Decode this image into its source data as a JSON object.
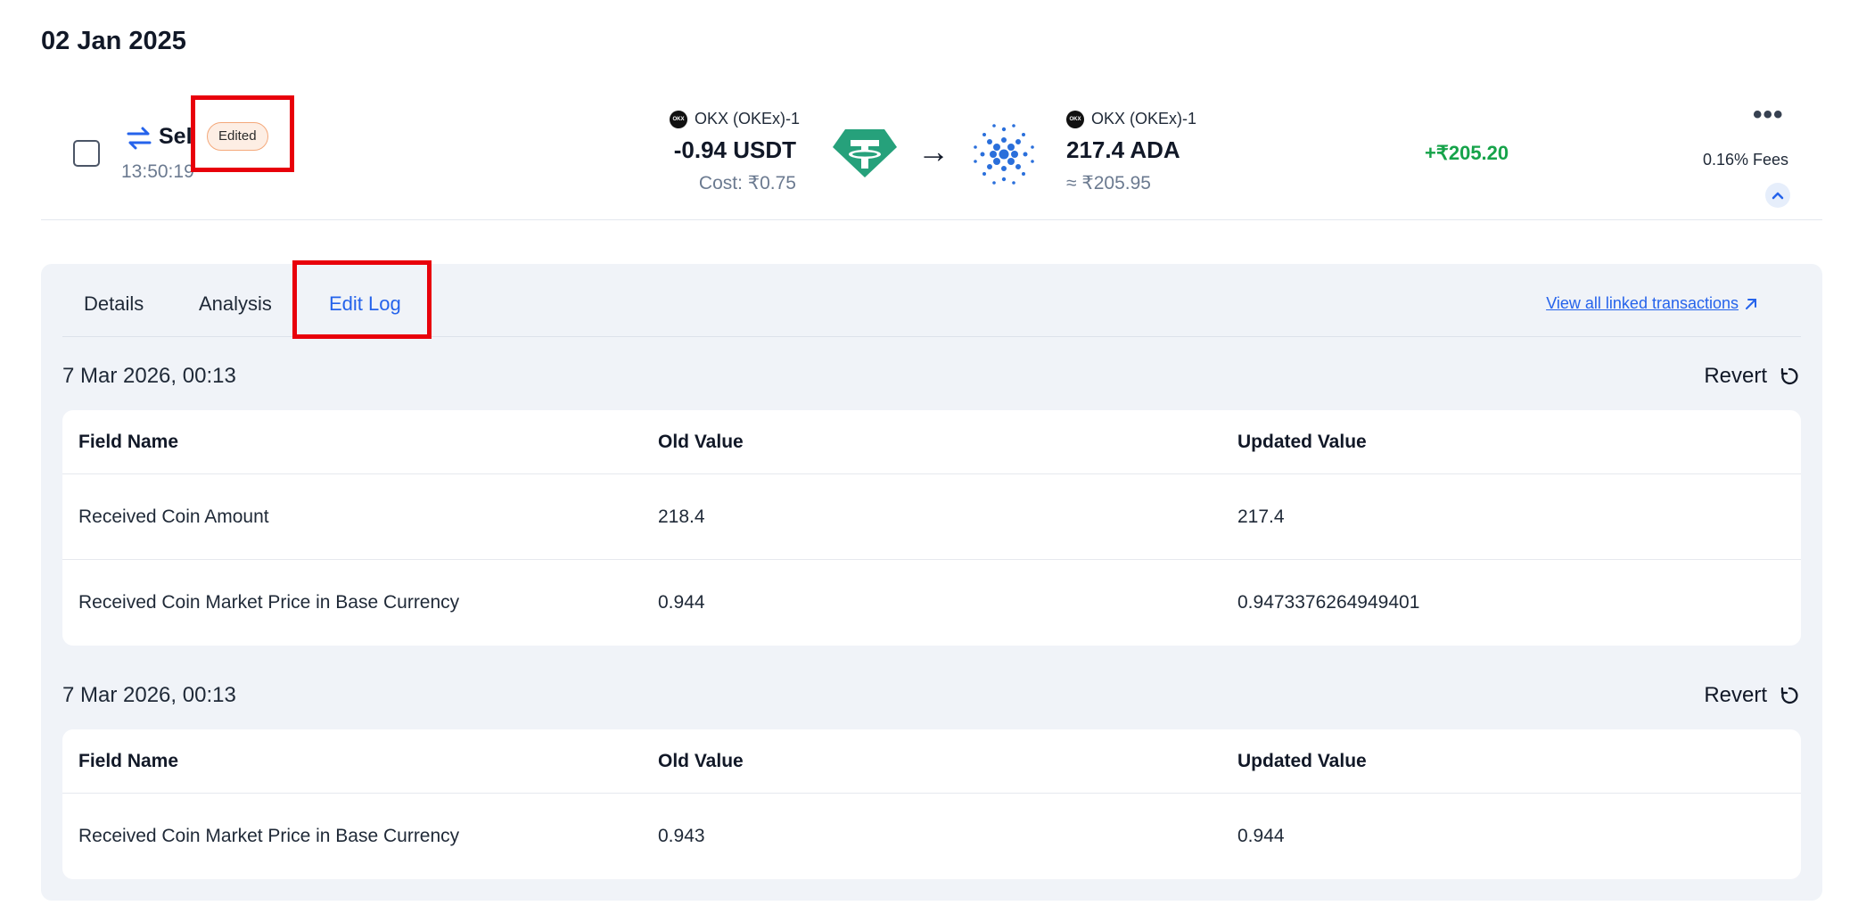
{
  "date_header": "02 Jan 2025",
  "transaction": {
    "type_label": "Sell",
    "edited_badge": "Edited",
    "time": "13:50:19",
    "sent": {
      "exchange": "OKX (OKEx)-1",
      "exchange_logo_text": "OKX",
      "amount": "-0.94 USDT",
      "cost": "Cost: ₹0.75",
      "coin_icon": "tether-icon"
    },
    "received": {
      "exchange": "OKX (OKEx)-1",
      "exchange_logo_text": "OKX",
      "amount": "217.4 ADA",
      "value": "≈ ₹205.95",
      "coin_icon": "cardano-icon"
    },
    "pnl": "+₹205.20",
    "fees": "0.16% Fees",
    "more_label": "•••"
  },
  "tabs": [
    {
      "label": "Details",
      "active": false
    },
    {
      "label": "Analysis",
      "active": false
    },
    {
      "label": "Edit Log",
      "active": true
    }
  ],
  "linked_link": "View all linked transactions",
  "edit_log": [
    {
      "timestamp": "7 Mar 2026, 00:13",
      "revert_label": "Revert",
      "headers": [
        "Field Name",
        "Old Value",
        "Updated Value"
      ],
      "rows": [
        [
          "Received Coin Amount",
          "218.4",
          "217.4"
        ],
        [
          "Received Coin Market Price in Base Currency",
          "0.944",
          "0.9473376264949401"
        ]
      ]
    },
    {
      "timestamp": "7 Mar 2026, 00:13",
      "revert_label": "Revert",
      "headers": [
        "Field Name",
        "Old Value",
        "Updated Value"
      ],
      "rows": [
        [
          "Received Coin Market Price in Base Currency",
          "0.943",
          "0.944"
        ]
      ]
    }
  ],
  "colors": {
    "accent": "#2563eb",
    "positive": "#16a34a",
    "highlight": "#e8000b",
    "panel_bg": "#f0f3f8",
    "tether": "#26a17b",
    "cardano": "#2a6fdb"
  }
}
